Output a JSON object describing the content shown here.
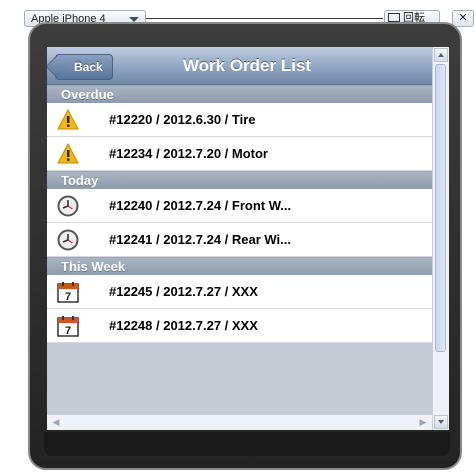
{
  "toolbar": {
    "device_label": "Apple iPhone 4",
    "rotate_label": "回転",
    "close_label": "✕"
  },
  "nav": {
    "back_label": "Back",
    "title": "Work Order List"
  },
  "sections": [
    {
      "header": "Overdue",
      "items": [
        {
          "icon": "warning-icon",
          "text": "#12220 / 2012.6.30 / Tire"
        },
        {
          "icon": "warning-icon",
          "text": "#12234 / 2012.7.20 / Motor"
        }
      ]
    },
    {
      "header": "Today",
      "items": [
        {
          "icon": "clock-icon",
          "text": "#12240 / 2012.7.24 / Front W..."
        },
        {
          "icon": "clock-icon",
          "text": "#12241 / 2012.7.24 / Rear Wi..."
        }
      ]
    },
    {
      "header": "This Week",
      "items": [
        {
          "icon": "calendar-icon",
          "text": "#12245 / 2012.7.27 / XXX"
        },
        {
          "icon": "calendar-icon",
          "text": "#12248 / 2012.7.27 / XXX"
        }
      ]
    }
  ],
  "calendar_day": "7",
  "colors": {
    "warning": "#f5b800",
    "calendar_top": "#c85a1e",
    "nav_bar": "#8fa5c2"
  }
}
